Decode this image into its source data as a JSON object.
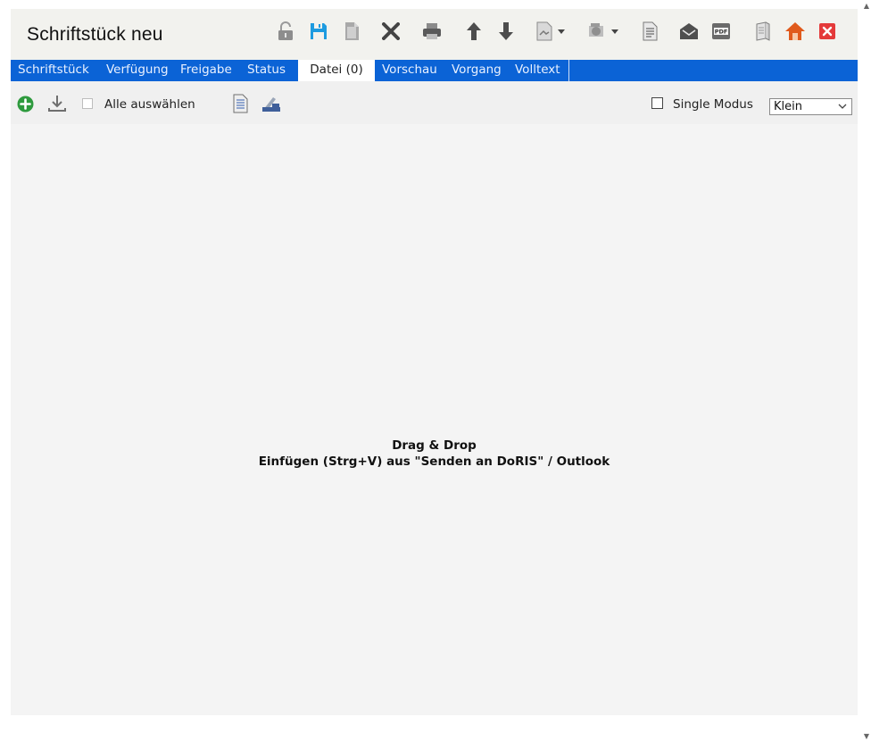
{
  "window": {
    "title": "Schriftstück  neu"
  },
  "toolbar": {
    "icons": [
      "lock-icon",
      "save-icon",
      "copy-icon",
      "close-x-icon",
      "print-icon",
      "arrow-up-icon",
      "arrow-down-icon",
      "document-dropdown-icon",
      "stamp-dropdown-icon",
      "document-icon",
      "envelope-icon",
      "pdf-icon",
      "book-icon",
      "home-icon",
      "close-window-icon"
    ],
    "pdf_badge": "PDF"
  },
  "tabs": [
    {
      "label": "Schriftstück"
    },
    {
      "label": "Verfügung"
    },
    {
      "label": "Freigabe"
    },
    {
      "label": "Status"
    },
    {
      "label": "Datei (0)",
      "active": true
    },
    {
      "label": "Vorschau"
    },
    {
      "label": "Vorgang"
    },
    {
      "label": "Volltext"
    }
  ],
  "filebar": {
    "select_all_label": "Alle auswählen",
    "single_mode_label": "Single Modus",
    "size_select_value": "Klein"
  },
  "dropzone": {
    "line1": "Drag & Drop",
    "line2": "Einfügen (Strg+V) aus \"Senden an DoRIS\" / Outlook"
  },
  "colors": {
    "tab_bar": "#0b63d6",
    "save_icon": "#1e9be0",
    "close_window": "#e43a3a",
    "home_icon": "#e05a1c",
    "add_button": "#2e9a3e"
  }
}
